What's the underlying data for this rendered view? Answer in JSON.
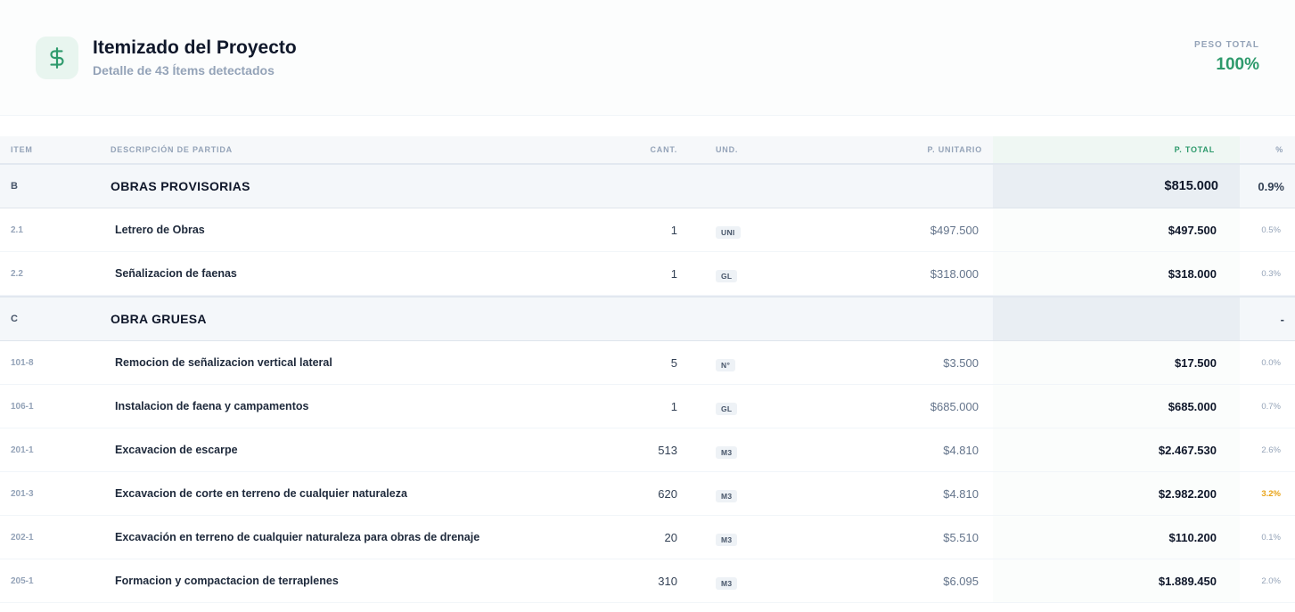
{
  "header": {
    "title": "Itemizado del Proyecto",
    "subtitle": "Detalle de 43 Ítems detectados",
    "peso_label": "PESO TOTAL",
    "peso_value": "100%",
    "icon": "dollar-icon",
    "accent_color": "#2e9a6c"
  },
  "table": {
    "columns": {
      "item": "ITEM",
      "desc": "DESCRIPCIÓN DE PARTIDA",
      "cant": "CANT.",
      "und": "UND.",
      "punit": "P. UNITARIO",
      "ptotal": "P. TOTAL",
      "pct": "%"
    },
    "sections": [
      {
        "code": "B",
        "name": "OBRAS PROVISORIAS",
        "total": "$815.000",
        "pct": "0.9%",
        "items": [
          {
            "item": "2.1",
            "desc": "Letrero de Obras",
            "cant": "1",
            "und": "UNI",
            "punit": "$497.500",
            "ptotal": "$497.500",
            "pct": "0.5%"
          },
          {
            "item": "2.2",
            "desc": "Señalizacion de faenas",
            "cant": "1",
            "und": "GL",
            "punit": "$318.000",
            "ptotal": "$318.000",
            "pct": "0.3%"
          }
        ]
      },
      {
        "code": "C",
        "name": "OBRA GRUESA",
        "total": "",
        "pct": "-",
        "items": [
          {
            "item": "101-8",
            "desc": "Remocion de señalizacion vertical lateral",
            "cant": "5",
            "und": "N°",
            "punit": "$3.500",
            "ptotal": "$17.500",
            "pct": "0.0%"
          },
          {
            "item": "106-1",
            "desc": "Instalacion de faena y campamentos",
            "cant": "1",
            "und": "GL",
            "punit": "$685.000",
            "ptotal": "$685.000",
            "pct": "0.7%"
          },
          {
            "item": "201-1",
            "desc": "Excavacion de escarpe",
            "cant": "513",
            "und": "M3",
            "punit": "$4.810",
            "ptotal": "$2.467.530",
            "pct": "2.6%"
          },
          {
            "item": "201-3",
            "desc": "Excavacion de corte en terreno de cualquier naturaleza",
            "cant": "620",
            "und": "M3",
            "punit": "$4.810",
            "ptotal": "$2.982.200",
            "pct": "3.2%"
          },
          {
            "item": "202-1",
            "desc": "Excavación en terreno de cualquier naturaleza para obras de drenaje",
            "cant": "20",
            "und": "M3",
            "punit": "$5.510",
            "ptotal": "$110.200",
            "pct": "0.1%"
          },
          {
            "item": "205-1",
            "desc": "Formacion y compactacion de terraplenes",
            "cant": "310",
            "und": "M3",
            "punit": "$6.095",
            "ptotal": "$1.889.450",
            "pct": "2.0%"
          }
        ]
      }
    ]
  }
}
